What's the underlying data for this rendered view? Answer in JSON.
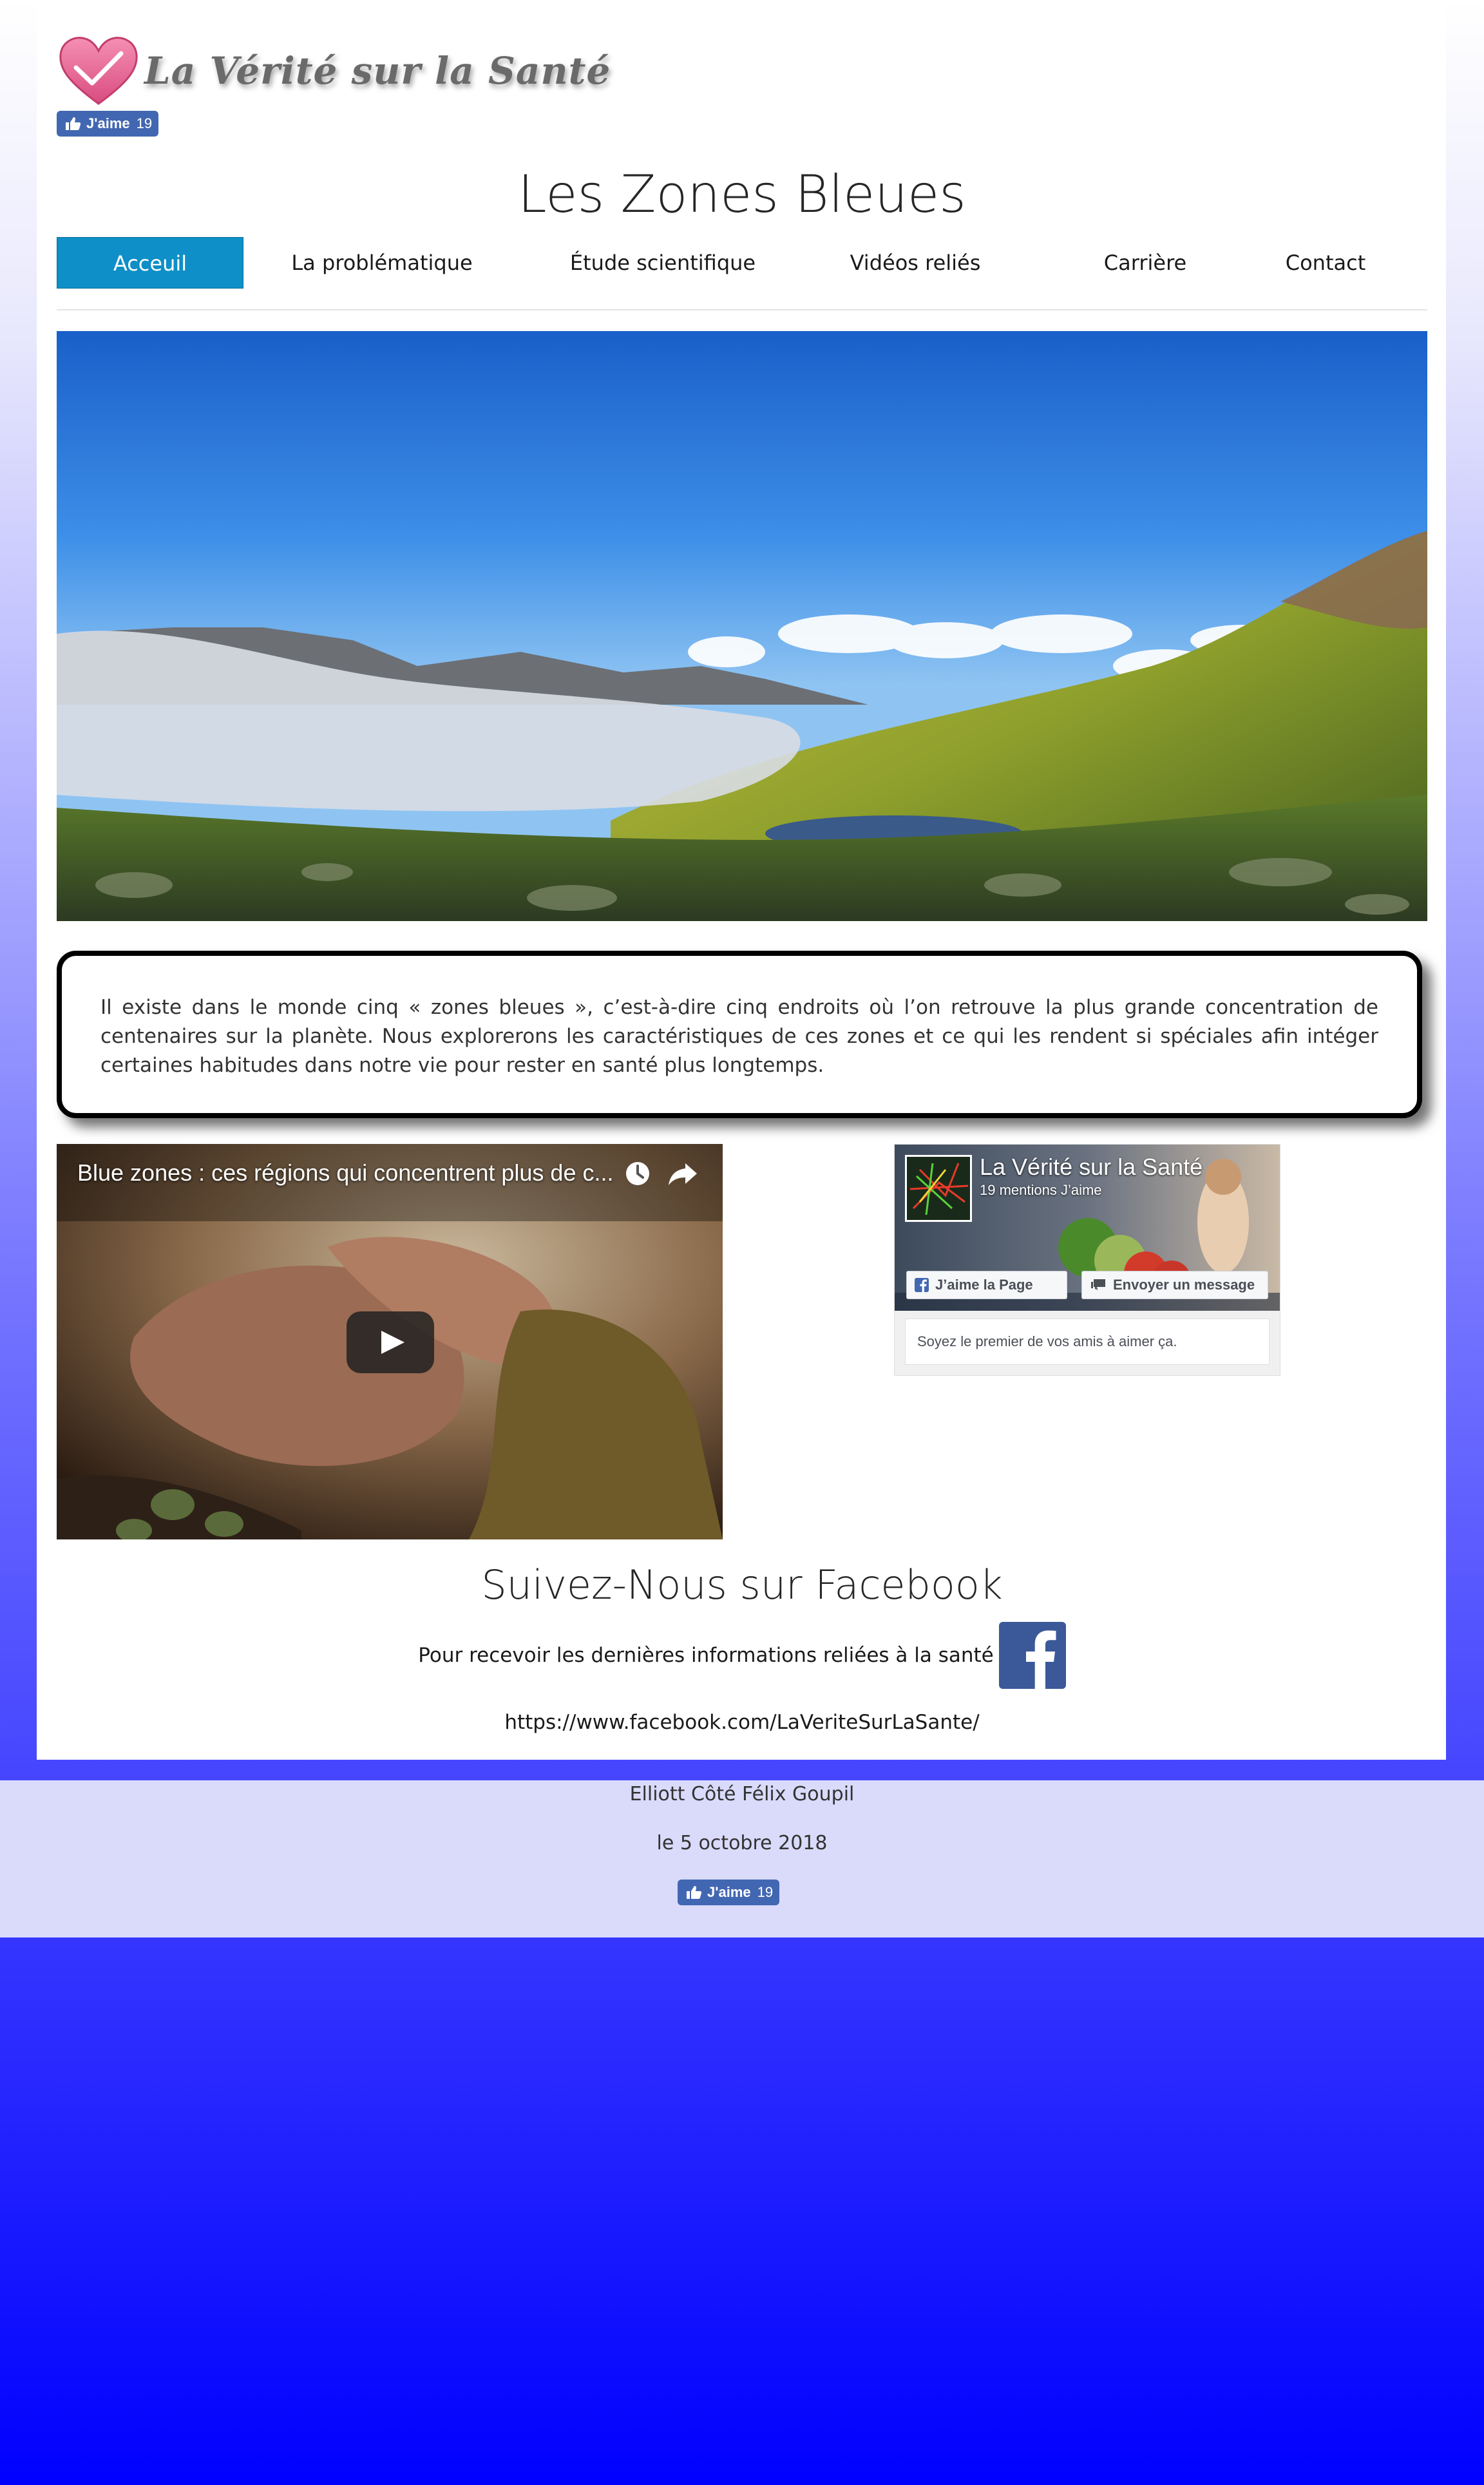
{
  "site": {
    "logo_text": "La Vérité sur la Santé",
    "title": "Les Zones Bleues"
  },
  "fb_like": {
    "label": "J'aime",
    "count": "19"
  },
  "nav": {
    "items": [
      {
        "label": "Acceuil",
        "active": true
      },
      {
        "label": "La problématique"
      },
      {
        "label": "Étude scientifique"
      },
      {
        "label": "Vidéos reliés"
      },
      {
        "label": "Carrière"
      },
      {
        "label": "Contact"
      }
    ]
  },
  "intro": {
    "text": "Il existe dans le monde cinq « zones bleues », c’est-à-dire cinq endroits où l’on retrouve la plus grande concentration de centenaires sur la planète. Nous explorerons les caractéristiques de ces zones et ce qui les rendent si spéciales afin intéger certaines habitudes dans notre vie pour rester en santé plus longtemps."
  },
  "video": {
    "title": "Blue zones : ces régions qui concentrent plus de c..."
  },
  "fb_page": {
    "name": "La Vérité sur la Santé",
    "likes": "19 mentions J’aime",
    "like_button": "J’aime la Page",
    "message_button": "Envoyer un message",
    "friends_text": "Soyez le premier de vos amis à aimer ça."
  },
  "follow": {
    "title": "Suivez-Nous sur Facebook",
    "text": "Pour recevoir les dernières informations reliées à la santé",
    "url": "https://www.facebook.com/LaVeriteSurLaSante/"
  },
  "footer": {
    "author": "Elliott Côté Félix Goupil",
    "date": "le 5 octobre 2018"
  },
  "colors": {
    "nav_active": "#0e8fc7",
    "facebook": "#4267b2",
    "footer_bg": "#dadafb"
  }
}
